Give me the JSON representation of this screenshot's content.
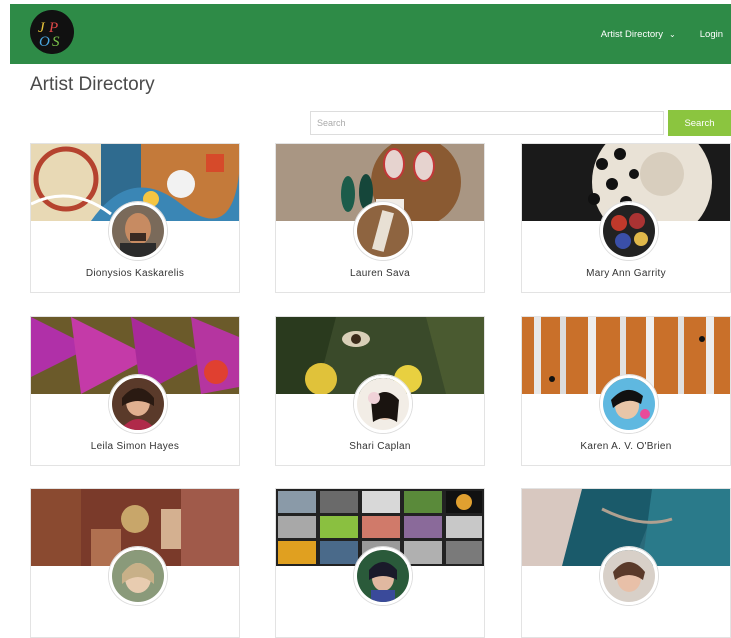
{
  "header": {
    "logo_text": "JPOS",
    "nav": [
      {
        "label": "Artist Directory",
        "has_dropdown": true
      },
      {
        "label": "Login",
        "has_dropdown": false
      }
    ],
    "background": "#2e8b47"
  },
  "page": {
    "title": "Artist Directory"
  },
  "search": {
    "placeholder": "Search",
    "value": "",
    "button_label": "Search",
    "button_color": "#8bc53f"
  },
  "artists": [
    {
      "name": "Dionysios Kaskarelis"
    },
    {
      "name": "Lauren Sava"
    },
    {
      "name": "Mary Ann Garrity"
    },
    {
      "name": "Leila Simon Hayes"
    },
    {
      "name": "Shari Caplan"
    },
    {
      "name": "Karen A. V. O'Brien"
    },
    {
      "name": ""
    },
    {
      "name": ""
    },
    {
      "name": ""
    }
  ]
}
